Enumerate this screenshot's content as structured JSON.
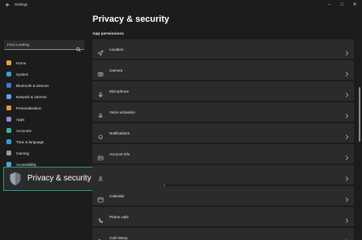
{
  "titlebar": {
    "title": "Settings",
    "back_icon": "back-arrow-icon",
    "minimize": "–",
    "maximize": "□",
    "close": "✕"
  },
  "sidebar": {
    "search_placeholder": "Find a setting",
    "items": [
      {
        "label": "Home",
        "icon": "home-icon",
        "color": "#e8a33b"
      },
      {
        "label": "System",
        "icon": "system-icon",
        "color": "#3a9bdc"
      },
      {
        "label": "Bluetooth & devices",
        "icon": "bluetooth-icon",
        "color": "#3a7bd5"
      },
      {
        "label": "Network & internet",
        "icon": "network-icon",
        "color": "#5ba7e6"
      },
      {
        "label": "Personalisation",
        "icon": "brush-icon",
        "color": "#e59a2f"
      },
      {
        "label": "Apps",
        "icon": "apps-icon",
        "color": "#8a8fd9"
      },
      {
        "label": "Accounts",
        "icon": "accounts-icon",
        "color": "#2fb5a0"
      },
      {
        "label": "Time & language",
        "icon": "time-language-icon",
        "color": "#3a9bdc"
      },
      {
        "label": "Gaming",
        "icon": "gaming-icon",
        "color": "#9a9a9a"
      },
      {
        "label": "Accessibility",
        "icon": "accessibility-icon",
        "color": "#4aa3e0"
      }
    ],
    "selected": {
      "label": "Privacy & security",
      "icon": "shield-icon"
    }
  },
  "main": {
    "title": "Privacy & security",
    "section": "App permissions",
    "rows": [
      {
        "label": "Location",
        "icon": "location-icon"
      },
      {
        "label": "Camera",
        "icon": "camera-icon"
      },
      {
        "label": "Microphone",
        "icon": "microphone-icon"
      },
      {
        "label": "Voice activation",
        "icon": "voice-activation-icon"
      },
      {
        "label": "Notifications",
        "icon": "notifications-icon"
      },
      {
        "label": "Account info",
        "icon": "account-info-icon"
      },
      {
        "label": "",
        "icon": "contacts-icon"
      },
      {
        "label": "Calendar",
        "icon": "calendar-icon"
      },
      {
        "label": "Phone calls",
        "icon": "phone-calls-icon"
      },
      {
        "label": "Call history",
        "icon": "call-history-icon"
      }
    ]
  },
  "colors": {
    "background": "#1c1c1c",
    "card": "#2b2b2b",
    "highlight_border": "#1fa37a"
  }
}
